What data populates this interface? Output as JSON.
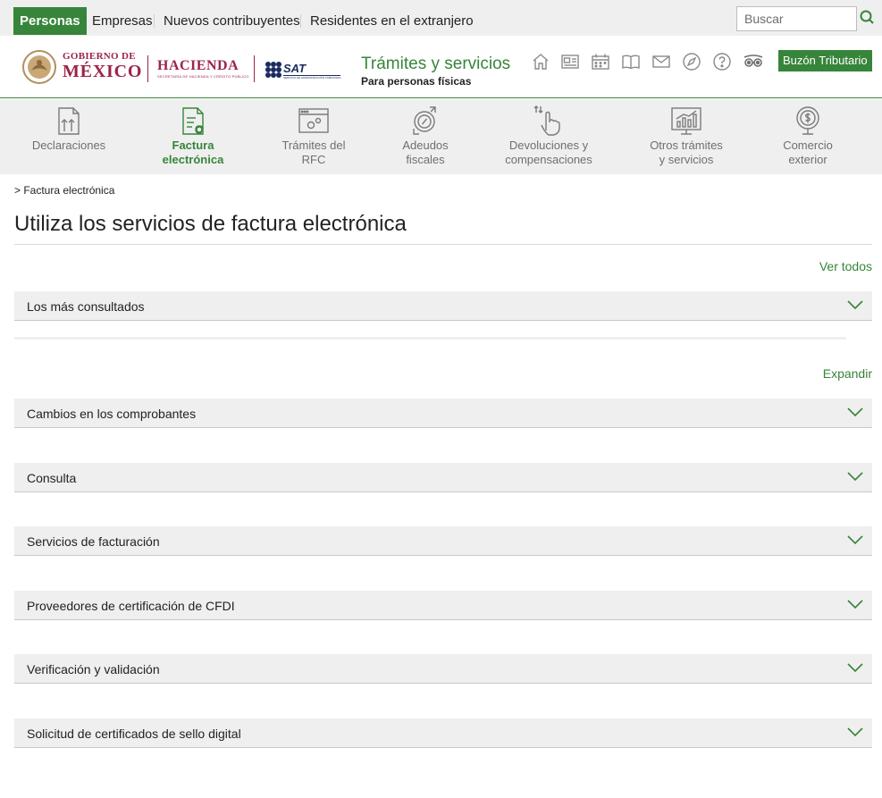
{
  "topbar": {
    "tabs": [
      {
        "label": "Personas"
      },
      {
        "label": "Empresas"
      },
      {
        "label": "Nuevos contribuyentes"
      },
      {
        "label": "Residentes en el extranjero"
      }
    ],
    "search_placeholder": "Buscar",
    "icons": {
      "search": "search-icon"
    }
  },
  "header": {
    "logos": {
      "gob_line1": "GOBIERNO DE",
      "gob_line2": "MÉXICO",
      "hacienda": "HACIENDA",
      "hacienda_sub": "SECRETARÍA DE HACIENDA Y CRÉDITO PÚBLICO",
      "sat": "SAT",
      "sat_sub": "SERVICIO DE ADMINISTRACIÓN TRIBUTARIA"
    },
    "title": "Trámites y servicios",
    "subtitle": "Para personas físicas",
    "icons": [
      "home-icon",
      "news-icon",
      "calendar-icon",
      "book-icon",
      "mail-icon",
      "compass-icon",
      "help-icon",
      "accessibility-icon"
    ],
    "buzon_label": "Buzón Tributario"
  },
  "categories": [
    {
      "line1": "Declaraciones",
      "line2": "",
      "icon": "declaraciones-icon"
    },
    {
      "line1": "Factura",
      "line2": "electrónica",
      "icon": "factura-icon"
    },
    {
      "line1": "Trámites del",
      "line2": "RFC",
      "icon": "rfc-icon"
    },
    {
      "line1": "Adeudos",
      "line2": "fiscales",
      "icon": "adeudos-icon"
    },
    {
      "line1": "Devoluciones y",
      "line2": "compensaciones",
      "icon": "devoluciones-icon"
    },
    {
      "line1": "Otros trámites",
      "line2": "y servicios",
      "icon": "otros-icon"
    },
    {
      "line1": "Comercio",
      "line2": "exterior",
      "icon": "comercio-icon"
    }
  ],
  "breadcrumb": "> Factura electrónica",
  "page_title": "Utiliza los servicios de factura electrónica",
  "ver_todos": "Ver todos",
  "expandir": "Expandir",
  "most_consulted": "Los más consultados",
  "sections": [
    {
      "label": "Cambios en los comprobantes"
    },
    {
      "label": "Consulta"
    },
    {
      "label": "Servicios de facturación"
    },
    {
      "label": "Proveedores de certificación de CFDI"
    },
    {
      "label": "Verificación y validación"
    },
    {
      "label": "Solicitud de certificados de sello digital"
    }
  ],
  "colors": {
    "brand_green": "#37853a",
    "gob_red": "#9d2449",
    "sat_blue": "#1a2b5f",
    "bar_gray": "#efefef"
  }
}
